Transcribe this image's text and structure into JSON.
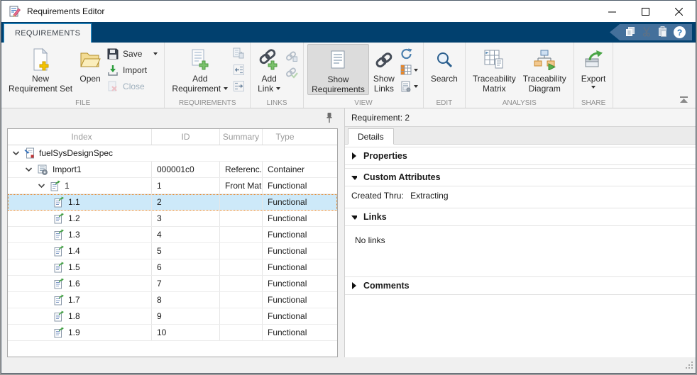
{
  "window": {
    "title": "Requirements Editor"
  },
  "ribbon": {
    "tab": "REQUIREMENTS",
    "file": {
      "label": "FILE",
      "new_line1": "New",
      "new_line2": "Requirement Set",
      "open": "Open",
      "save": "Save",
      "import": "Import",
      "close": "Close"
    },
    "requirements": {
      "label": "REQUIREMENTS",
      "add_line1": "Add",
      "add_line2": "Requirement"
    },
    "links": {
      "label": "LINKS",
      "add_line1": "Add",
      "add_line2": "Link"
    },
    "view": {
      "label": "VIEW",
      "show_requirements_line1": "Show",
      "show_requirements_line2": "Requirements",
      "show_links_line1": "Show",
      "show_links_line2": "Links"
    },
    "edit": {
      "label": "EDIT",
      "search": "Search"
    },
    "analysis": {
      "label": "ANALYSIS",
      "matrix_line1": "Traceability",
      "matrix_line2": "Matrix",
      "diagram_line1": "Traceability",
      "diagram_line2": "Diagram"
    },
    "share": {
      "label": "SHARE",
      "export": "Export"
    }
  },
  "tree": {
    "columns": [
      "Index",
      "ID",
      "Summary",
      "Type"
    ],
    "rows": [
      {
        "index": "fuelSysDesignSpec",
        "id": "",
        "summary": "",
        "type": ""
      },
      {
        "index": "Import1",
        "id": "000001c0",
        "summary": "Referenc...",
        "type": "Container"
      },
      {
        "index": "1",
        "id": "1",
        "summary": "Front Mat...",
        "type": "Functional"
      },
      {
        "index": "1.1",
        "id": "2",
        "summary": "",
        "type": "Functional"
      },
      {
        "index": "1.2",
        "id": "3",
        "summary": "",
        "type": "Functional"
      },
      {
        "index": "1.3",
        "id": "4",
        "summary": "",
        "type": "Functional"
      },
      {
        "index": "1.4",
        "id": "5",
        "summary": "",
        "type": "Functional"
      },
      {
        "index": "1.5",
        "id": "6",
        "summary": "",
        "type": "Functional"
      },
      {
        "index": "1.6",
        "id": "7",
        "summary": "",
        "type": "Functional"
      },
      {
        "index": "1.7",
        "id": "8",
        "summary": "",
        "type": "Functional"
      },
      {
        "index": "1.8",
        "id": "9",
        "summary": "",
        "type": "Functional"
      },
      {
        "index": "1.9",
        "id": "10",
        "summary": "",
        "type": "Functional"
      }
    ]
  },
  "details": {
    "header": "Requirement: 2",
    "tab": "Details",
    "properties": "Properties",
    "custom_attributes": "Custom Attributes",
    "created_thru_label": "Created Thru:",
    "created_thru_value": "Extracting",
    "links": "Links",
    "no_links": "No links",
    "comments": "Comments"
  },
  "icons": {
    "app": "document-with-pencil",
    "quick_access": [
      "copy",
      "cut",
      "paste",
      "help"
    ],
    "tree": {
      "requirement_set": "page-blue-arrow-red-dot",
      "import_node": "list-with-gear",
      "requirement": "page-green-arrow"
    },
    "pin": "pushpin",
    "collapse_ribbon": "bar-over-up-arrow"
  },
  "colors": {
    "ribbon_band": "#01406e",
    "tab_border": "#2e9bd6",
    "selection_bg": "#cde9f9",
    "selection_border": "#e8821e",
    "pressed_button": "#dcdcdc"
  }
}
